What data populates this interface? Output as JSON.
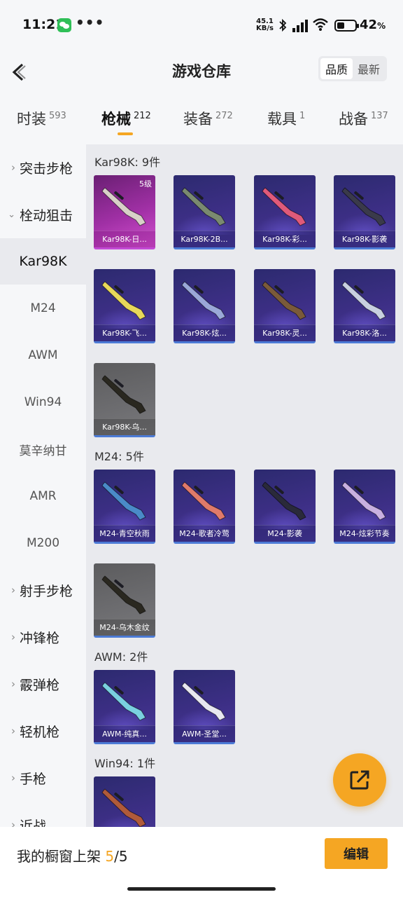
{
  "status_bar": {
    "time": "11:21",
    "dots": "•••",
    "net_speed_value": "45.1",
    "net_speed_unit": "KB/s",
    "battery_percent": "42",
    "battery_level": 0.42
  },
  "header": {
    "title": "游戏仓库",
    "sort_options": [
      "品质",
      "最新"
    ],
    "active_sort": "品质"
  },
  "tabs": [
    {
      "label": "时装",
      "count": "593"
    },
    {
      "label": "枪械",
      "count": "212",
      "active": true
    },
    {
      "label": "装备",
      "count": "272"
    },
    {
      "label": "载具",
      "count": "1"
    },
    {
      "label": "战备",
      "count": "137"
    }
  ],
  "sidebar": {
    "items": [
      {
        "label": "突击步枪",
        "expandable": true
      },
      {
        "label": "栓动狙击",
        "expandable": true,
        "expanded": true
      },
      {
        "label": "Kar98K",
        "sub": true,
        "selected": true
      },
      {
        "label": "M24",
        "sub": true
      },
      {
        "label": "AWM",
        "sub": true
      },
      {
        "label": "Win94",
        "sub": true
      },
      {
        "label": "莫辛纳甘",
        "sub": true
      },
      {
        "label": "AMR",
        "sub": true
      },
      {
        "label": "M200",
        "sub": true
      },
      {
        "label": "射手步枪",
        "expandable": true
      },
      {
        "label": "冲锋枪",
        "expandable": true
      },
      {
        "label": "霰弹枪",
        "expandable": true
      },
      {
        "label": "轻机枪",
        "expandable": true
      },
      {
        "label": "手枪",
        "expandable": true
      },
      {
        "label": "近战",
        "expandable": true
      }
    ]
  },
  "groups": [
    {
      "title": "Kar98K: 9件",
      "items": [
        {
          "label": "Kar98K-日...",
          "level": "5级",
          "style": "pink",
          "gun_color": "#d8d0c8"
        },
        {
          "label": "Kar98K-2B...",
          "style": "purple",
          "gun_color": "#7a8a70"
        },
        {
          "label": "Kar98K-彩...",
          "style": "purple",
          "gun_color": "#e05a7a"
        },
        {
          "label": "Kar98K-影袭",
          "style": "purple",
          "gun_color": "#3a3a4a"
        },
        {
          "label": "Kar98K-飞...",
          "style": "purple",
          "gun_color": "#e8d85a"
        },
        {
          "label": "Kar98K-炫...",
          "style": "purple",
          "gun_color": "#9aa8d8"
        },
        {
          "label": "Kar98K-灵...",
          "style": "purple",
          "gun_color": "#7a5a3a"
        },
        {
          "label": "Kar98K-洛...",
          "style": "purple",
          "gun_color": "#c8d0e0"
        },
        {
          "label": "Kar98K-乌...",
          "style": "gray",
          "gun_color": "#2a2820"
        }
      ]
    },
    {
      "title": "M24: 5件",
      "items": [
        {
          "label": "M24-青空秋雨",
          "style": "purple",
          "gun_color": "#4a8ac8"
        },
        {
          "label": "M24-歌者冷莺",
          "style": "purple",
          "gun_color": "#e07a6a"
        },
        {
          "label": "M24-影袭",
          "style": "purple",
          "gun_color": "#2a2a3a"
        },
        {
          "label": "M24-炫彩节奏",
          "style": "purple",
          "gun_color": "#c8b0e0"
        },
        {
          "label": "M24-乌木金纹",
          "style": "gray",
          "gun_color": "#2a2820"
        }
      ]
    },
    {
      "title": "AWM: 2件",
      "items": [
        {
          "label": "AWM-纯真...",
          "style": "purple",
          "gun_color": "#7ad0e0"
        },
        {
          "label": "AWM-圣堂...",
          "style": "purple",
          "gun_color": "#e8e8f0"
        }
      ]
    },
    {
      "title": "Win94: 1件",
      "items": [
        {
          "label": "",
          "style": "purple",
          "gun_color": "#b05a3a"
        }
      ]
    }
  ],
  "bottom": {
    "showcase_label": "我的橱窗上架",
    "showcase_current": "5",
    "showcase_separator": "/",
    "showcase_total": "5",
    "edit_label": "编辑"
  },
  "colors": {
    "accent": "#f5a623",
    "card_purple": "#3d2f86",
    "card_pink": "#a030a5",
    "card_gray": "#6d6d70"
  }
}
